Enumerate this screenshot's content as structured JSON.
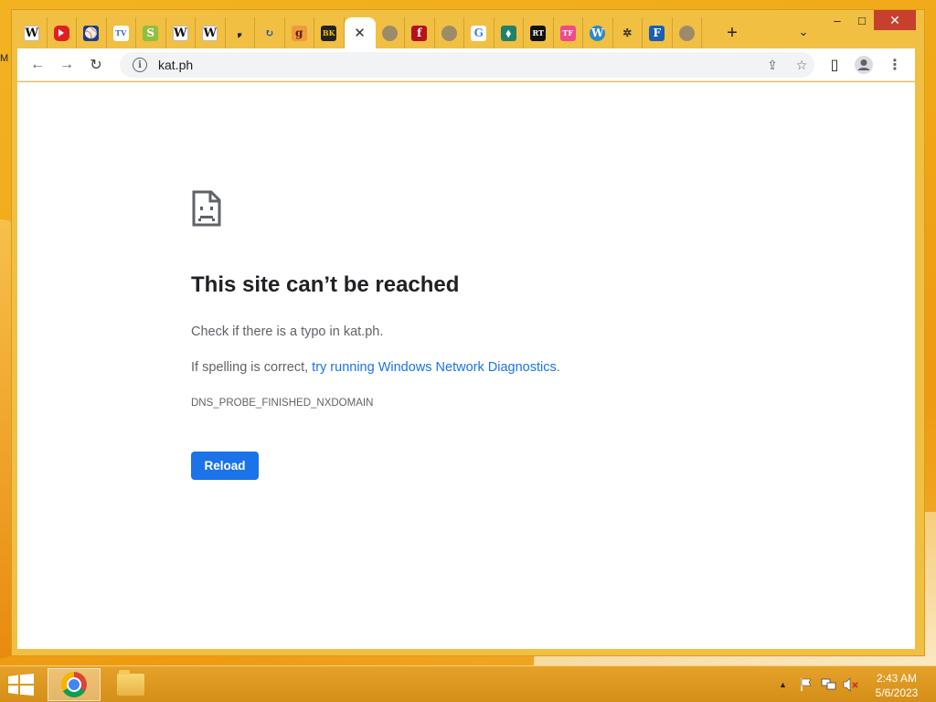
{
  "desktop": {
    "edge_label": "M"
  },
  "browser": {
    "tabs": [
      {
        "icon": "wikipedia-icon",
        "glyph": "W",
        "kind": "wiki"
      },
      {
        "icon": "youtube-icon",
        "glyph": "",
        "kind": "yt"
      },
      {
        "icon": "mlb-icon",
        "glyph": "⚾",
        "kind": "mlb"
      },
      {
        "icon": "tv-icon",
        "glyph": "TV",
        "kind": "tv"
      },
      {
        "icon": "s-icon",
        "glyph": "S",
        "kind": "s"
      },
      {
        "icon": "wikipedia-icon",
        "glyph": "W",
        "kind": "wiki"
      },
      {
        "icon": "wikipedia-icon",
        "glyph": "W",
        "kind": "wiki"
      },
      {
        "icon": "y-icon",
        "glyph": "𝓎",
        "kind": "y"
      },
      {
        "icon": "refresh-arrow-icon",
        "glyph": "↻",
        "kind": "arrow"
      },
      {
        "icon": "g-bracket-icon",
        "glyph": "g",
        "kind": "gb"
      },
      {
        "icon": "bk-icon",
        "glyph": "BK",
        "kind": "bk"
      },
      {
        "icon": "close-icon",
        "glyph": "✕",
        "kind": "active"
      },
      {
        "icon": "globe-icon",
        "glyph": "",
        "kind": "globe"
      },
      {
        "icon": "f-icon",
        "glyph": "f",
        "kind": "f"
      },
      {
        "icon": "globe-icon",
        "glyph": "",
        "kind": "globe"
      },
      {
        "icon": "google-icon",
        "glyph": "G",
        "kind": "google"
      },
      {
        "icon": "map-icon",
        "glyph": "⬧",
        "kind": "map"
      },
      {
        "icon": "rt-icon",
        "glyph": "RT",
        "kind": "rt"
      },
      {
        "icon": "tf-icon",
        "glyph": "TF",
        "kind": "tf"
      },
      {
        "icon": "wordpress-icon",
        "glyph": "W",
        "kind": "wp"
      },
      {
        "icon": "gear-icon",
        "glyph": "✲",
        "kind": "gear"
      },
      {
        "icon": "f-square-icon",
        "glyph": "F",
        "kind": "fsq"
      },
      {
        "icon": "globe-icon",
        "glyph": "",
        "kind": "globe"
      }
    ],
    "new_tab": "+",
    "tab_search": "⌄",
    "window_controls": {
      "minimize": "–",
      "maximize": "□",
      "close": "✕"
    },
    "toolbar": {
      "back": "←",
      "forward": "→",
      "reload": "↻",
      "url": "kat.ph",
      "info": "i"
    },
    "omnibox_icons": {
      "share": "⇪",
      "star": "☆"
    },
    "side_panel": "▯",
    "menu": "⋮"
  },
  "error_page": {
    "title": "This site can’t be reached",
    "line1": "Check if there is a typo in kat.ph.",
    "line2_prefix": "If spelling is correct, ",
    "line2_link": "try running Windows Network Diagnostics",
    "line2_suffix": ".",
    "code": "DNS_PROBE_FINISHED_NXDOMAIN",
    "reload_label": "Reload"
  },
  "taskbar": {
    "clock_time": "2:43 AM",
    "clock_date": "5/6/2023",
    "tray_up": "▲"
  },
  "colors": {
    "accent": "#1a73e8",
    "frame": "#f1bf42",
    "close_red": "#c7402d"
  }
}
